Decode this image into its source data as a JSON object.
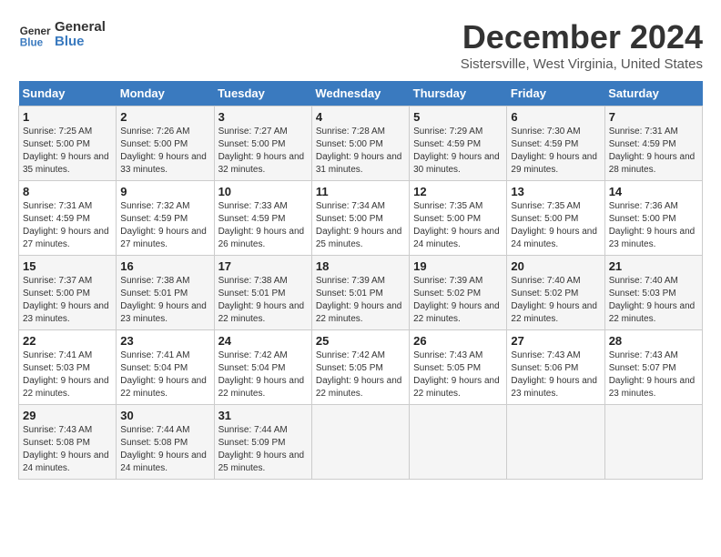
{
  "logo": {
    "line1": "General",
    "line2": "Blue"
  },
  "title": "December 2024",
  "subtitle": "Sistersville, West Virginia, United States",
  "weekdays": [
    "Sunday",
    "Monday",
    "Tuesday",
    "Wednesday",
    "Thursday",
    "Friday",
    "Saturday"
  ],
  "weeks": [
    [
      {
        "day": "1",
        "sunrise": "7:25 AM",
        "sunset": "5:00 PM",
        "daylight": "9 hours and 35 minutes."
      },
      {
        "day": "2",
        "sunrise": "7:26 AM",
        "sunset": "5:00 PM",
        "daylight": "9 hours and 33 minutes."
      },
      {
        "day": "3",
        "sunrise": "7:27 AM",
        "sunset": "5:00 PM",
        "daylight": "9 hours and 32 minutes."
      },
      {
        "day": "4",
        "sunrise": "7:28 AM",
        "sunset": "5:00 PM",
        "daylight": "9 hours and 31 minutes."
      },
      {
        "day": "5",
        "sunrise": "7:29 AM",
        "sunset": "4:59 PM",
        "daylight": "9 hours and 30 minutes."
      },
      {
        "day": "6",
        "sunrise": "7:30 AM",
        "sunset": "4:59 PM",
        "daylight": "9 hours and 29 minutes."
      },
      {
        "day": "7",
        "sunrise": "7:31 AM",
        "sunset": "4:59 PM",
        "daylight": "9 hours and 28 minutes."
      }
    ],
    [
      {
        "day": "8",
        "sunrise": "7:31 AM",
        "sunset": "4:59 PM",
        "daylight": "9 hours and 27 minutes."
      },
      {
        "day": "9",
        "sunrise": "7:32 AM",
        "sunset": "4:59 PM",
        "daylight": "9 hours and 27 minutes."
      },
      {
        "day": "10",
        "sunrise": "7:33 AM",
        "sunset": "4:59 PM",
        "daylight": "9 hours and 26 minutes."
      },
      {
        "day": "11",
        "sunrise": "7:34 AM",
        "sunset": "5:00 PM",
        "daylight": "9 hours and 25 minutes."
      },
      {
        "day": "12",
        "sunrise": "7:35 AM",
        "sunset": "5:00 PM",
        "daylight": "9 hours and 24 minutes."
      },
      {
        "day": "13",
        "sunrise": "7:35 AM",
        "sunset": "5:00 PM",
        "daylight": "9 hours and 24 minutes."
      },
      {
        "day": "14",
        "sunrise": "7:36 AM",
        "sunset": "5:00 PM",
        "daylight": "9 hours and 23 minutes."
      }
    ],
    [
      {
        "day": "15",
        "sunrise": "7:37 AM",
        "sunset": "5:00 PM",
        "daylight": "9 hours and 23 minutes."
      },
      {
        "day": "16",
        "sunrise": "7:38 AM",
        "sunset": "5:01 PM",
        "daylight": "9 hours and 23 minutes."
      },
      {
        "day": "17",
        "sunrise": "7:38 AM",
        "sunset": "5:01 PM",
        "daylight": "9 hours and 22 minutes."
      },
      {
        "day": "18",
        "sunrise": "7:39 AM",
        "sunset": "5:01 PM",
        "daylight": "9 hours and 22 minutes."
      },
      {
        "day": "19",
        "sunrise": "7:39 AM",
        "sunset": "5:02 PM",
        "daylight": "9 hours and 22 minutes."
      },
      {
        "day": "20",
        "sunrise": "7:40 AM",
        "sunset": "5:02 PM",
        "daylight": "9 hours and 22 minutes."
      },
      {
        "day": "21",
        "sunrise": "7:40 AM",
        "sunset": "5:03 PM",
        "daylight": "9 hours and 22 minutes."
      }
    ],
    [
      {
        "day": "22",
        "sunrise": "7:41 AM",
        "sunset": "5:03 PM",
        "daylight": "9 hours and 22 minutes."
      },
      {
        "day": "23",
        "sunrise": "7:41 AM",
        "sunset": "5:04 PM",
        "daylight": "9 hours and 22 minutes."
      },
      {
        "day": "24",
        "sunrise": "7:42 AM",
        "sunset": "5:04 PM",
        "daylight": "9 hours and 22 minutes."
      },
      {
        "day": "25",
        "sunrise": "7:42 AM",
        "sunset": "5:05 PM",
        "daylight": "9 hours and 22 minutes."
      },
      {
        "day": "26",
        "sunrise": "7:43 AM",
        "sunset": "5:05 PM",
        "daylight": "9 hours and 22 minutes."
      },
      {
        "day": "27",
        "sunrise": "7:43 AM",
        "sunset": "5:06 PM",
        "daylight": "9 hours and 23 minutes."
      },
      {
        "day": "28",
        "sunrise": "7:43 AM",
        "sunset": "5:07 PM",
        "daylight": "9 hours and 23 minutes."
      }
    ],
    [
      {
        "day": "29",
        "sunrise": "7:43 AM",
        "sunset": "5:08 PM",
        "daylight": "9 hours and 24 minutes."
      },
      {
        "day": "30",
        "sunrise": "7:44 AM",
        "sunset": "5:08 PM",
        "daylight": "9 hours and 24 minutes."
      },
      {
        "day": "31",
        "sunrise": "7:44 AM",
        "sunset": "5:09 PM",
        "daylight": "9 hours and 25 minutes."
      },
      null,
      null,
      null,
      null
    ]
  ]
}
